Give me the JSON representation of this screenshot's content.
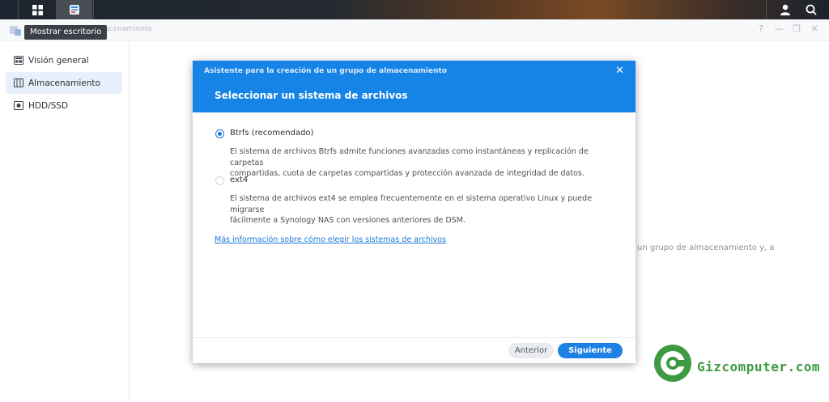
{
  "taskbar": {
    "apps": [
      {
        "name": "main-menu-icon"
      },
      {
        "name": "storage-manager-app-icon"
      }
    ],
    "right_icons": [
      "user-icon",
      "search-icon"
    ]
  },
  "window": {
    "title_suffix": "lmacenamiento",
    "tooltip": "Mostrar escritorio",
    "controls": [
      "?",
      "—",
      "❐",
      "✕"
    ]
  },
  "sidebar": {
    "items": [
      {
        "label": "Visión general",
        "icon": "overview-icon",
        "selected": false
      },
      {
        "label": "Almacenamiento",
        "icon": "storage-icon",
        "selected": true
      },
      {
        "label": "HDD/SSD",
        "icon": "hdd-icon",
        "selected": false
      }
    ]
  },
  "background_text": "un grupo de almacenamiento y, a",
  "modal": {
    "wizard_title": "Asistente para la creación de un grupo de almacenamiento",
    "title": "Seleccionar un sistema de archivos",
    "options": [
      {
        "label": "Btrfs (recomendado)",
        "selected": true,
        "description_line1": "El sistema de archivos Btrfs admite funciones avanzadas como instantáneas y replicación de carpetas",
        "description_line2": "compartidas, cuota de carpetas compartidas y protección avanzada de integridad de datos."
      },
      {
        "label": "ext4",
        "selected": false,
        "description_line1": "El sistema de archivos ext4 se emplea frecuentemente en el sistema operativo Linux y puede migrarse",
        "description_line2": "fácilmente a Synology NAS con versiones anteriores de DSM."
      }
    ],
    "link": "Más información sobre cómo elegir los sistemas de archivos",
    "buttons": {
      "prev": "Anterior",
      "next": "Siguiente"
    },
    "close": "✕"
  },
  "watermark": {
    "text": "Gizcomputer.com",
    "color": "#3e9a42"
  },
  "colors": {
    "accent": "#1684e6",
    "selected_nav": "#e7f0fb"
  }
}
